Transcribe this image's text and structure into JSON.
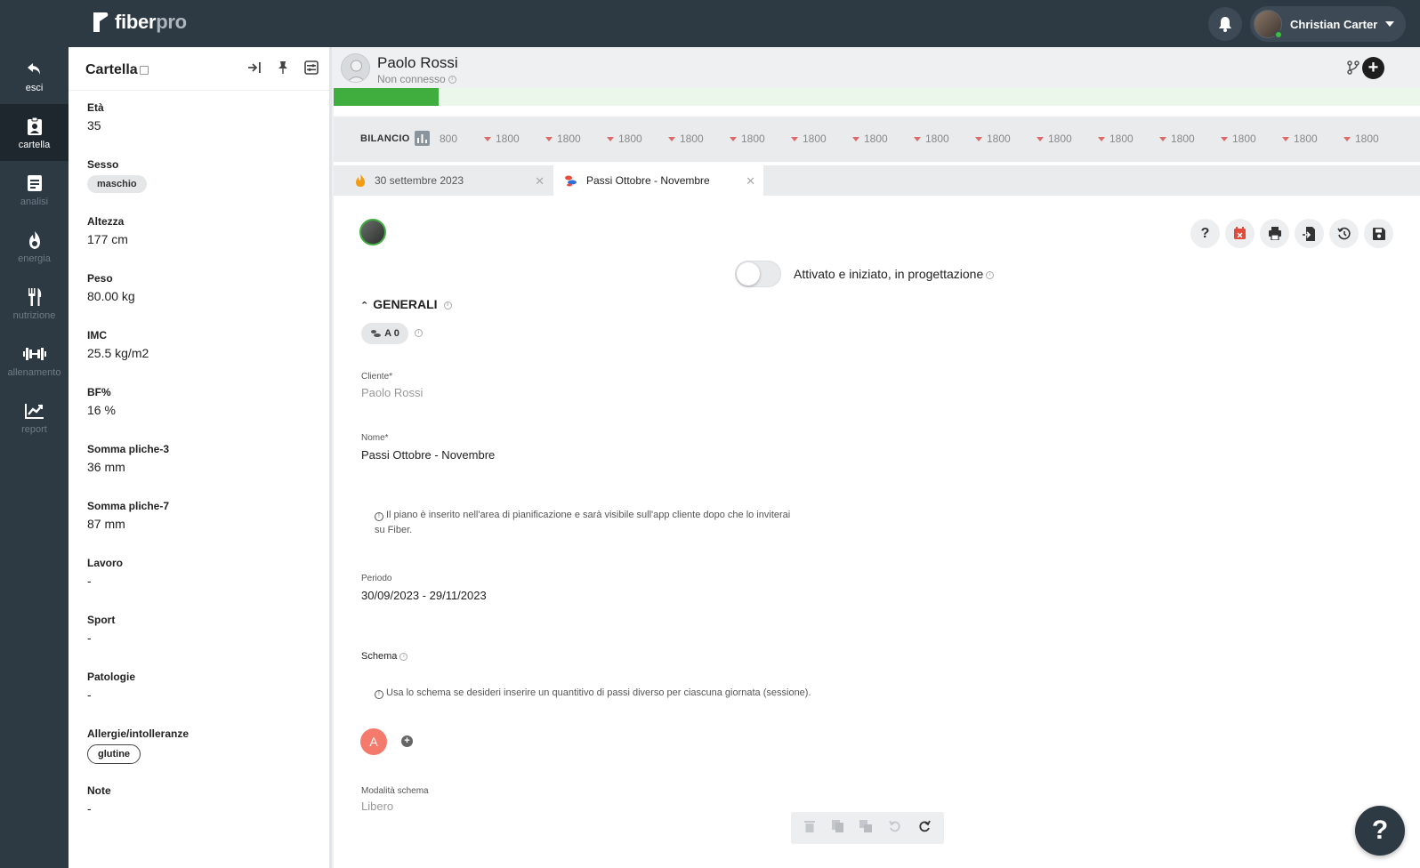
{
  "brand": {
    "name_main": "fiber",
    "name_suffix": "pro"
  },
  "user": {
    "name": "Christian Carter"
  },
  "nav": {
    "exit": "esci",
    "items": [
      "cartella",
      "analisi",
      "energia",
      "nutrizione",
      "allenamento",
      "report"
    ]
  },
  "cartella": {
    "title": "Cartella",
    "fields": [
      {
        "label": "Età",
        "value": "35"
      },
      {
        "label": "Sesso",
        "pill": "maschio"
      },
      {
        "label": "Altezza",
        "value": "177 cm"
      },
      {
        "label": "Peso",
        "value": "80.00 kg"
      },
      {
        "label": "IMC",
        "value": "25.5 kg/m2"
      },
      {
        "label": "BF%",
        "value": "16 %"
      },
      {
        "label": "Somma pliche-3",
        "value": "36 mm"
      },
      {
        "label": "Somma pliche-7",
        "value": "87 mm"
      },
      {
        "label": "Lavoro",
        "value": "-"
      },
      {
        "label": "Sport",
        "value": "-"
      },
      {
        "label": "Patologie",
        "value": "-"
      },
      {
        "label": "Allergie/intolleranze",
        "pill": "glutine"
      },
      {
        "label": "Note",
        "value": "-"
      }
    ]
  },
  "client": {
    "name": "Paolo Rossi",
    "status": "Non connesso"
  },
  "bilancio": {
    "label": "BILANCIO",
    "first": "800",
    "values": [
      "1800",
      "1800",
      "1800",
      "1800",
      "1800",
      "1800",
      "1800",
      "1800",
      "1800",
      "1800",
      "1800",
      "1800",
      "1800",
      "1800",
      "1800"
    ]
  },
  "tabs": [
    {
      "label": "30 settembre 2023",
      "active": false
    },
    {
      "label": "Passi Ottobre - Novembre",
      "active": true
    }
  ],
  "plan": {
    "toggle_label": "Attivato e iniziato, in progettazione",
    "toggle_on": false,
    "section_title": "GENERALI",
    "chip": "A 0",
    "cliente_label": "Cliente*",
    "cliente_value": "Paolo Rossi",
    "nome_label": "Nome*",
    "nome_value": "Passi Ottobre - Novembre",
    "note_plan_line1": "Il piano è inserito nell'area di pianificazione e sarà visibile sull'app cliente dopo che lo inviterai",
    "note_plan_line2": "su Fiber.",
    "periodo_label": "Periodo",
    "periodo_value": "30/09/2023 - 29/11/2023",
    "schema_label": "Schema",
    "schema_note": "Usa lo schema se desideri inserire un quantitivo di passi diverso per ciascuna giornata (sessione).",
    "schema_item": "A",
    "modalita_label": "Modalità schema",
    "modalita_value": "Libero"
  },
  "help_fab": "?",
  "colors": {
    "nav_bg": "#2d3943",
    "accent_green": "#3fae3f",
    "schema_a": "#f47b6b",
    "delete_red": "#e04a3a"
  }
}
